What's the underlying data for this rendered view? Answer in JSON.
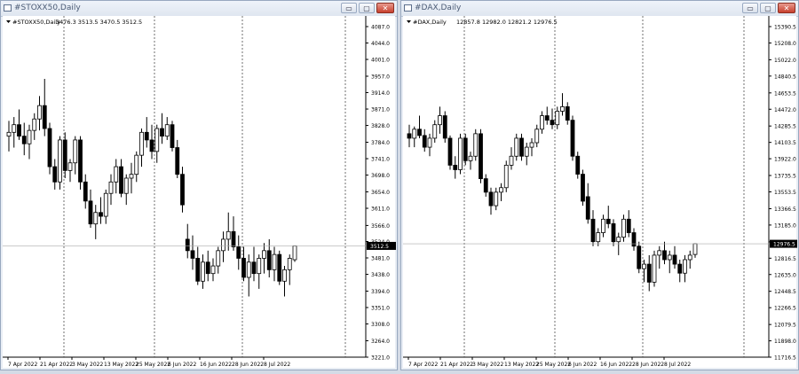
{
  "windows": [
    {
      "title": "#STOXX50,Daily",
      "info_symbol": "#STOXX50,Daily",
      "info_ohlc": "3476.3 3513.5 3470.5 3512.5",
      "y_ticks": [
        "4087.0",
        "4044.0",
        "4001.0",
        "3957.0",
        "3914.0",
        "3871.0",
        "3828.0",
        "3784.0",
        "3741.0",
        "3698.0",
        "3654.0",
        "3611.0",
        "3566.0",
        "3524.0",
        "3481.0",
        "3438.0",
        "3394.0",
        "3351.0",
        "3308.0",
        "3264.0",
        "3221.0"
      ],
      "price_label": "3512.5",
      "x_ticks": [
        "7 Apr 2022",
        "21 Apr 2022",
        "3 May 2022",
        "13 May 2022",
        "25 May 2022",
        "6 Jun 2022",
        "16 Jun 2022",
        "28 Jun 2022",
        "8 Jul 2022"
      ],
      "buttons": {
        "minimize": "▭",
        "maximize": "▢",
        "close": "✕"
      }
    },
    {
      "title": "#DAX,Daily",
      "info_symbol": "#DAX,Daily",
      "info_ohlc": "12857.8 12982.0 12821.2 12976.5",
      "y_ticks": [
        "15390.5",
        "15208.0",
        "15022.0",
        "14840.5",
        "14653.5",
        "14472.0",
        "14285.5",
        "14103.5",
        "13922.0",
        "13735.5",
        "13553.5",
        "13366.5",
        "13185.0",
        "12998.0",
        "12816.5",
        "12635.0",
        "12448.5",
        "12266.5",
        "12079.5",
        "11898.0",
        "11716.5"
      ],
      "price_label": "12976.5",
      "x_ticks": [
        "7 Apr 2022",
        "21 Apr 2022",
        "3 May 2022",
        "13 May 2022",
        "25 May 2022",
        "6 Jun 2022",
        "16 Jun 2022",
        "28 Jun 2022",
        "8 Jul 2022"
      ],
      "buttons": {
        "minimize": "▭",
        "maximize": "▢",
        "close": "✕"
      }
    }
  ],
  "chart_data": [
    {
      "type": "candlestick",
      "title": "#STOXX50,Daily",
      "ylim": [
        3221.0,
        4087.0
      ],
      "last_price": 3512.5,
      "ohlc": [
        [
          3800,
          3840,
          3760,
          3810
        ],
        [
          3810,
          3850,
          3770,
          3830
        ],
        [
          3830,
          3870,
          3790,
          3800
        ],
        [
          3800,
          3835,
          3750,
          3780
        ],
        [
          3780,
          3830,
          3740,
          3815
        ],
        [
          3815,
          3860,
          3790,
          3845
        ],
        [
          3845,
          3905,
          3815,
          3880
        ],
        [
          3880,
          3950,
          3800,
          3820
        ],
        [
          3820,
          3835,
          3700,
          3720
        ],
        [
          3720,
          3740,
          3660,
          3680
        ],
        [
          3680,
          3800,
          3660,
          3790
        ],
        [
          3790,
          3810,
          3690,
          3710
        ],
        [
          3710,
          3740,
          3680,
          3730
        ],
        [
          3730,
          3800,
          3700,
          3790
        ],
        [
          3790,
          3800,
          3660,
          3680
        ],
        [
          3680,
          3700,
          3610,
          3630
        ],
        [
          3630,
          3660,
          3560,
          3570
        ],
        [
          3570,
          3620,
          3530,
          3600
        ],
        [
          3600,
          3640,
          3570,
          3590
        ],
        [
          3590,
          3660,
          3570,
          3650
        ],
        [
          3650,
          3700,
          3620,
          3680
        ],
        [
          3680,
          3740,
          3650,
          3720
        ],
        [
          3720,
          3740,
          3640,
          3650
        ],
        [
          3650,
          3700,
          3620,
          3690
        ],
        [
          3690,
          3730,
          3650,
          3700
        ],
        [
          3700,
          3760,
          3680,
          3750
        ],
        [
          3750,
          3820,
          3720,
          3810
        ],
        [
          3810,
          3850,
          3770,
          3790
        ],
        [
          3790,
          3830,
          3740,
          3760
        ],
        [
          3760,
          3830,
          3730,
          3820
        ],
        [
          3820,
          3860,
          3780,
          3800
        ],
        [
          3800,
          3850,
          3790,
          3830
        ],
        [
          3830,
          3840,
          3760,
          3770
        ],
        [
          3770,
          3790,
          3690,
          3700
        ],
        [
          3700,
          3720,
          3600,
          3620
        ],
        [
          3530,
          3570,
          3480,
          3500
        ],
        [
          3500,
          3540,
          3450,
          3480
        ],
        [
          3480,
          3510,
          3410,
          3420
        ],
        [
          3420,
          3490,
          3400,
          3470
        ],
        [
          3470,
          3500,
          3420,
          3440
        ],
        [
          3440,
          3480,
          3420,
          3460
        ],
        [
          3460,
          3510,
          3440,
          3500
        ],
        [
          3500,
          3550,
          3470,
          3530
        ],
        [
          3530,
          3600,
          3500,
          3550
        ],
        [
          3550,
          3590,
          3500,
          3510
        ],
        [
          3510,
          3540,
          3450,
          3480
        ],
        [
          3480,
          3510,
          3420,
          3430
        ],
        [
          3430,
          3490,
          3380,
          3470
        ],
        [
          3470,
          3510,
          3420,
          3440
        ],
        [
          3440,
          3490,
          3400,
          3480
        ],
        [
          3480,
          3520,
          3440,
          3500
        ],
        [
          3500,
          3530,
          3430,
          3450
        ],
        [
          3450,
          3510,
          3420,
          3490
        ],
        [
          3490,
          3500,
          3410,
          3420
        ],
        [
          3420,
          3460,
          3380,
          3450
        ],
        [
          3450,
          3490,
          3410,
          3480
        ],
        [
          3476.3,
          3513.5,
          3470.5,
          3512.5
        ]
      ]
    },
    {
      "type": "candlestick",
      "title": "#DAX,Daily",
      "ylim": [
        11716.5,
        15390.5
      ],
      "last_price": 12976.5,
      "ohlc": [
        [
          14200,
          14300,
          14050,
          14150
        ],
        [
          14150,
          14280,
          14050,
          14250
        ],
        [
          14250,
          14400,
          14150,
          14180
        ],
        [
          14180,
          14250,
          14000,
          14050
        ],
        [
          14050,
          14200,
          13950,
          14150
        ],
        [
          14150,
          14350,
          14100,
          14300
        ],
        [
          14300,
          14500,
          14200,
          14400
        ],
        [
          14400,
          14450,
          14100,
          14150
        ],
        [
          14150,
          14180,
          13800,
          13850
        ],
        [
          13850,
          13950,
          13700,
          13800
        ],
        [
          13800,
          14200,
          13750,
          14150
        ],
        [
          14150,
          14200,
          13850,
          13900
        ],
        [
          13900,
          14000,
          13800,
          13950
        ],
        [
          13950,
          14250,
          13900,
          14200
        ],
        [
          14200,
          14250,
          13650,
          13700
        ],
        [
          13700,
          13750,
          13500,
          13550
        ],
        [
          13550,
          13600,
          13300,
          13400
        ],
        [
          13400,
          13600,
          13350,
          13550
        ],
        [
          13550,
          13650,
          13450,
          13600
        ],
        [
          13600,
          13900,
          13550,
          13850
        ],
        [
          13850,
          14050,
          13800,
          13950
        ],
        [
          13950,
          14200,
          13900,
          14150
        ],
        [
          14150,
          14200,
          13900,
          13950
        ],
        [
          13950,
          14100,
          13850,
          14050
        ],
        [
          14050,
          14150,
          13950,
          14100
        ],
        [
          14100,
          14300,
          14050,
          14250
        ],
        [
          14250,
          14450,
          14200,
          14400
        ],
        [
          14400,
          14500,
          14300,
          14350
        ],
        [
          14350,
          14480,
          14250,
          14300
        ],
        [
          14300,
          14500,
          14250,
          14450
        ],
        [
          14450,
          14650,
          14400,
          14500
        ],
        [
          14500,
          14550,
          14300,
          14350
        ],
        [
          14350,
          14400,
          13900,
          13950
        ],
        [
          13950,
          14000,
          13700,
          13750
        ],
        [
          13750,
          13800,
          13400,
          13450
        ],
        [
          13500,
          13650,
          13200,
          13250
        ],
        [
          13250,
          13350,
          12950,
          13000
        ],
        [
          13000,
          13150,
          12950,
          13100
        ],
        [
          13100,
          13300,
          13050,
          13250
        ],
        [
          13250,
          13400,
          13150,
          13200
        ],
        [
          13200,
          13250,
          12950,
          13000
        ],
        [
          13000,
          13100,
          12850,
          13050
        ],
        [
          13050,
          13300,
          13000,
          13250
        ],
        [
          13250,
          13350,
          13050,
          13100
        ],
        [
          13100,
          13150,
          12900,
          12950
        ],
        [
          12950,
          13000,
          12650,
          12700
        ],
        [
          12700,
          12800,
          12550,
          12750
        ],
        [
          12750,
          12850,
          12450,
          12550
        ],
        [
          12550,
          12900,
          12500,
          12850
        ],
        [
          12850,
          12950,
          12700,
          12900
        ],
        [
          12900,
          13000,
          12750,
          12800
        ],
        [
          12800,
          12900,
          12650,
          12850
        ],
        [
          12850,
          12950,
          12700,
          12750
        ],
        [
          12750,
          12800,
          12550,
          12650
        ],
        [
          12650,
          12850,
          12550,
          12800
        ],
        [
          12800,
          12900,
          12700,
          12850
        ],
        [
          12857.8,
          12982.0,
          12821.2,
          12976.5
        ]
      ]
    }
  ]
}
